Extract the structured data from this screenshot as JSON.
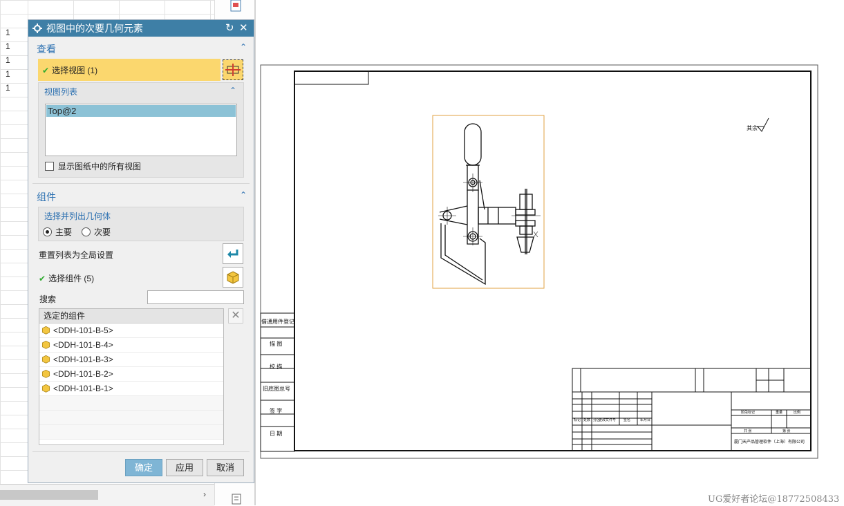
{
  "spreadsheet": {
    "row_values": [
      "1",
      "1",
      "1",
      "1",
      "1"
    ]
  },
  "dialog": {
    "title": "视图中的次要几何元素",
    "refresh_icon": "refresh-icon",
    "close_icon": "close-icon",
    "view_section": {
      "header": "查看",
      "select_view_label": "选择视图 (1)",
      "view_list_header": "视图列表",
      "view_list_items": [
        "Top@2"
      ],
      "show_all_label": "显示图纸中的所有视图"
    },
    "component_section": {
      "header": "组件",
      "select_geometry_header": "选择并列出几何体",
      "radio_primary": "主要",
      "radio_secondary": "次要",
      "reset_label": "重置列表为全局设置",
      "select_components_label": "选择组件 (5)",
      "search_label": "搜索",
      "search_value": "",
      "selected_header": "选定的组件",
      "selected_items": [
        "<DDH-101-B-5>",
        "<DDH-101-B-4>",
        "<DDH-101-B-3>",
        "<DDH-101-B-2>",
        "<DDH-101-B-1>"
      ]
    },
    "buttons": {
      "ok": "确定",
      "apply": "应用",
      "cancel": "取消"
    }
  },
  "drawing": {
    "surface_mark": "其余",
    "side_labels": [
      "借通用件登记",
      "描 图",
      "校 描",
      "旧底图总号",
      "签 字",
      "日 期"
    ],
    "title_block": {
      "revision_headers": [
        "标记",
        "处数",
        "分区",
        "更改文件号",
        "签名",
        "年月日"
      ],
      "company": "厦门天产品管理软件（上海）有限公司",
      "stage_label": "阶段标记",
      "weight_label": "重量",
      "scale_label": "比例",
      "sheets_label": "共 张",
      "sheet_label": "第 张"
    }
  },
  "watermark": "UG爱好者论坛@18772508433"
}
